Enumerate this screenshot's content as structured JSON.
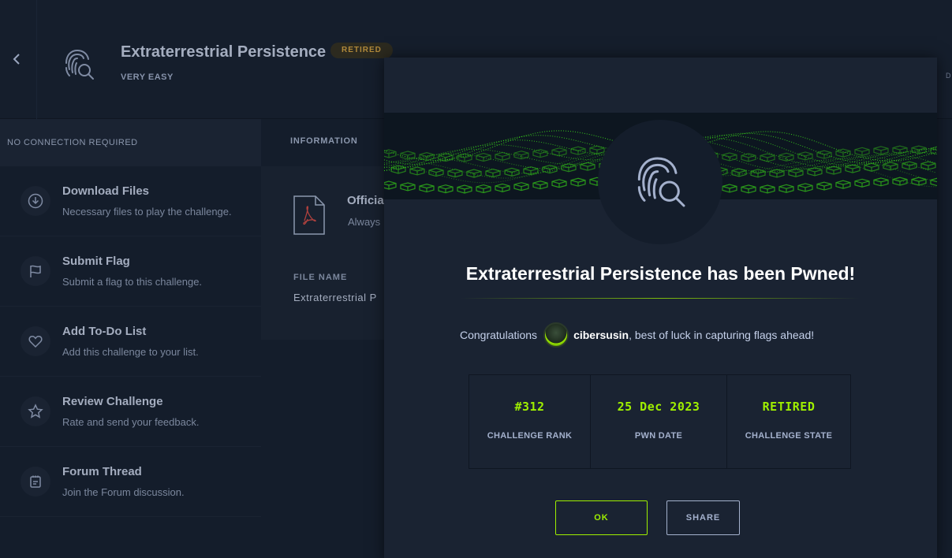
{
  "header": {
    "title": "Extraterrestrial Persistence",
    "status_badge": "RETIRED",
    "difficulty": "VERY EASY",
    "edge_text": "D"
  },
  "sidebar": {
    "connection": "NO CONNECTION REQUIRED",
    "actions": [
      {
        "title": "Download Files",
        "desc": "Necessary files to play the challenge.",
        "icon": "download-icon"
      },
      {
        "title": "Submit Flag",
        "desc": "Submit a flag to this challenge.",
        "icon": "flag-icon"
      },
      {
        "title": "Add To-Do List",
        "desc": "Add this challenge to your list.",
        "icon": "heart-icon"
      },
      {
        "title": "Review Challenge",
        "desc": "Rate and send your feedback.",
        "icon": "star-icon"
      },
      {
        "title": "Forum Thread",
        "desc": "Join the Forum discussion.",
        "icon": "forum-icon"
      }
    ]
  },
  "main": {
    "tab_label": "INFORMATION",
    "official_title": "Officia",
    "official_sub": "Always",
    "file_name_label": "FILE NAME",
    "file_name_value": "Extraterrestrial P"
  },
  "modal": {
    "title": "Extraterrestrial Persistence has been Pwned!",
    "congrats_prefix": "Congratulations",
    "username": "cibersusin",
    "congrats_suffix": ", best of luck in capturing flags ahead!",
    "stats": [
      {
        "value": "#312",
        "label": "CHALLENGE RANK"
      },
      {
        "value": "25 Dec 2023",
        "label": "PWN DATE"
      },
      {
        "value": "RETIRED",
        "label": "CHALLENGE STATE"
      }
    ],
    "ok_label": "OK",
    "share_label": "SHARE"
  },
  "colors": {
    "accent": "#9fef00",
    "background": "#141d2b",
    "modal_bg": "#1a2332"
  }
}
